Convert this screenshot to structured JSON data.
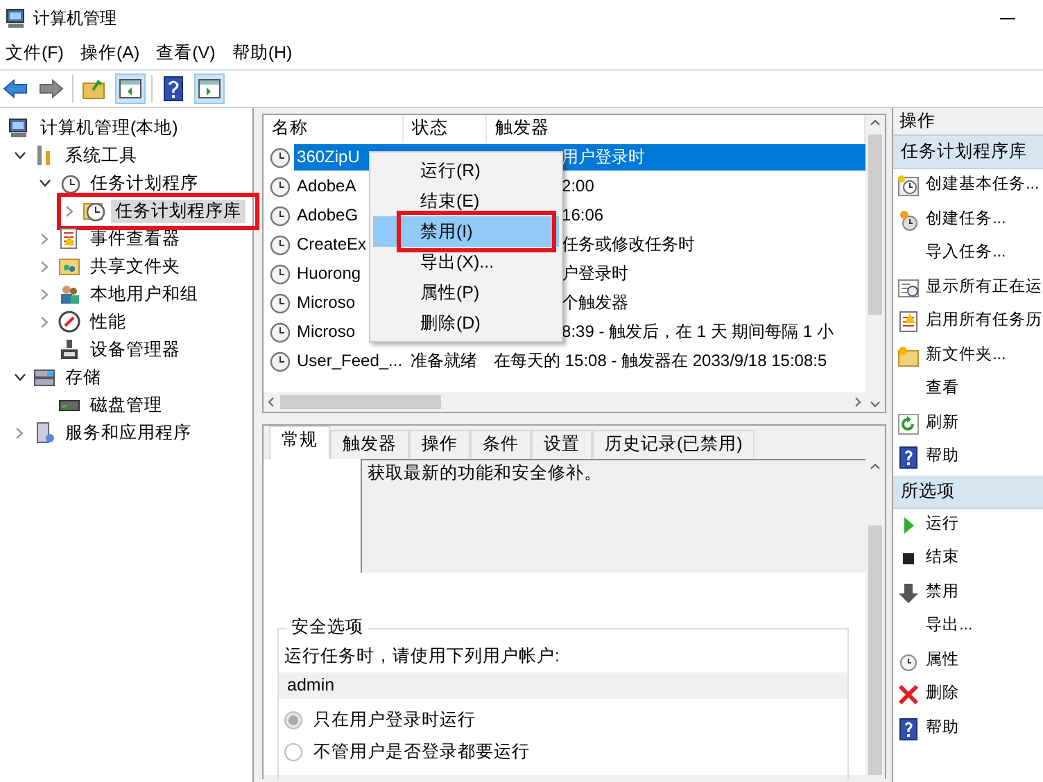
{
  "window": {
    "title": "计算机管理"
  },
  "menu_bar": [
    "文件(F)",
    "操作(A)",
    "查看(V)",
    "帮助(H)"
  ],
  "tree": [
    {
      "label": "计算机管理(本地)",
      "selected": false,
      "children": [
        {
          "label": "系统工具",
          "expanded": true,
          "selected": false,
          "children": [
            {
              "label": "任务计划程序",
              "expanded": true,
              "selected": false,
              "children": [
                {
                  "label": "任务计划程序库",
                  "expanded": false,
                  "selected": true,
                  "highlighted": true
                }
              ]
            },
            {
              "label": "事件查看器",
              "expanded": false,
              "selected": false
            },
            {
              "label": "共享文件夹",
              "expanded": false,
              "selected": false
            },
            {
              "label": "本地用户和组",
              "expanded": false,
              "selected": false
            },
            {
              "label": "性能",
              "expanded": false,
              "selected": false
            },
            {
              "label": "设备管理器",
              "selected": false
            }
          ]
        },
        {
          "label": "存储",
          "expanded": true,
          "selected": false,
          "children": [
            {
              "label": "磁盘管理",
              "selected": false
            }
          ]
        },
        {
          "label": "服务和应用程序",
          "expanded": false,
          "selected": false
        }
      ]
    }
  ],
  "task_table": {
    "columns": [
      "名称",
      "状态",
      "触发器"
    ],
    "rows": [
      {
        "name": "360ZipU",
        "trigger": "用户登录时",
        "selected": true
      },
      {
        "name": "AdobeA",
        "trigger": "2:00",
        "selected": false
      },
      {
        "name": "AdobeG",
        "trigger": "16:06",
        "selected": false
      },
      {
        "name": "CreateEx",
        "trigger": "任务或修改任务时",
        "selected": false
      },
      {
        "name": "Huorong",
        "trigger": "户登录时",
        "selected": false
      },
      {
        "name": "Microso",
        "trigger": "个触发器",
        "selected": false
      },
      {
        "name": "Microso",
        "trigger": "8:39 - 触发后，在 1 天 期间每隔 1 小",
        "selected": false
      },
      {
        "name": "User_Feed_...",
        "status": "准备就绪",
        "trigger": "在每天的 15:08 - 触发器在 2033/9/18 15:08:5",
        "selected": false
      }
    ]
  },
  "context_menu": [
    {
      "label": "运行(R)",
      "selected": false
    },
    {
      "label": "结束(E)",
      "selected": false
    },
    {
      "label": "禁用(I)",
      "selected": true,
      "highlighted": true
    },
    {
      "label": "导出(X)...",
      "selected": false
    },
    {
      "label": "属性(P)",
      "selected": false
    },
    {
      "label": "删除(D)",
      "selected": false
    }
  ],
  "detail_tabs": [
    {
      "label": "常规",
      "selected": true
    },
    {
      "label": "触发器",
      "selected": false
    },
    {
      "label": "操作",
      "selected": false
    },
    {
      "label": "条件",
      "selected": false
    },
    {
      "label": "设置",
      "selected": false
    },
    {
      "label": "历史记录(已禁用)",
      "selected": false
    }
  ],
  "general": {
    "description": "获取最新的功能和安全修补。",
    "security": {
      "legend": "安全选项",
      "account_label": "运行任务时，请使用下列用户帐户:",
      "account": "admin",
      "options": [
        {
          "label": "只在用户登录时运行",
          "selected": true
        },
        {
          "label": "不管用户是否登录都要运行",
          "selected": false
        }
      ]
    }
  },
  "actions": {
    "title": "操作",
    "sections": [
      {
        "title": "任务计划程序库",
        "items": [
          "创建基本任务...",
          "创建任务...",
          "导入任务...",
          "显示所有正在运",
          "启用所有任务历",
          "新文件夹...",
          "查看",
          "刷新",
          "帮助"
        ]
      },
      {
        "title": "所选项",
        "items": [
          "运行",
          "结束",
          "禁用",
          "导出...",
          "属性",
          "删除",
          "帮助"
        ]
      }
    ]
  }
}
